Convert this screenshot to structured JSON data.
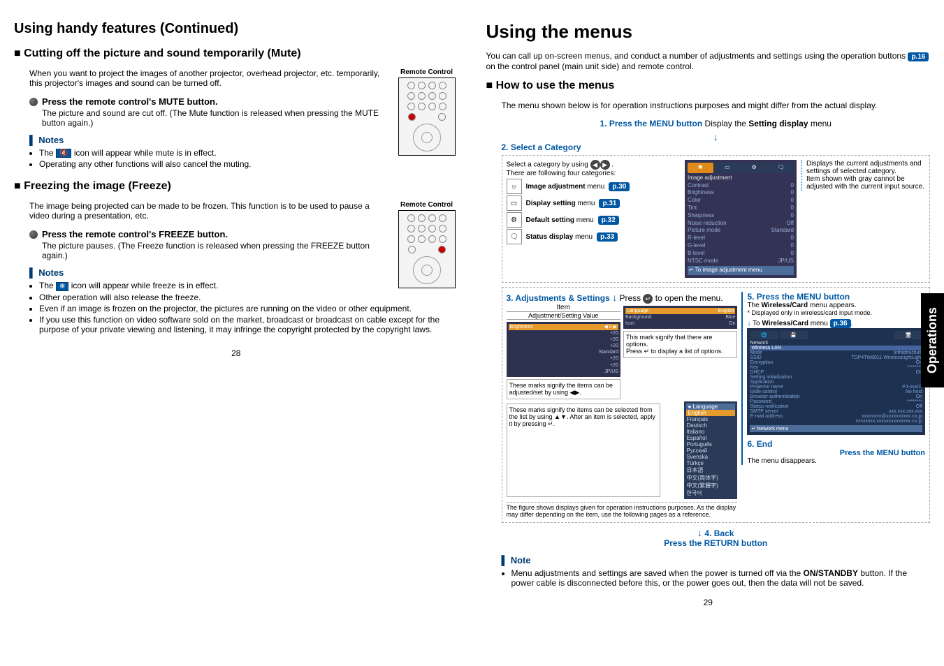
{
  "leftPage": {
    "title": "Using handy features (Continued)",
    "muteSection": {
      "heading": "Cutting off the picture and sound temporarily (Mute)",
      "intro": "When you want to project the images of another projector, overhead projector, etc. temporarily, this projector's images and sound can be turned off.",
      "remoteLabel": "Remote Control",
      "stepTitle": "Press the remote control's MUTE button.",
      "stepBody": "The picture and sound are cut off. (The Mute function is released when pressing the MUTE button again.)",
      "notesTitle": "Notes",
      "note1a": "The ",
      "note1icon": "🔇",
      "note1b": " icon will appear while mute is in effect.",
      "note2": "Operating any other functions will also cancel the muting."
    },
    "freezeSection": {
      "heading": "Freezing the image (Freeze)",
      "intro": "The image being projected can be made to be frozen. This function is to be used to pause a video during a presentation, etc.",
      "remoteLabel": "Remote Control",
      "stepTitle": "Press the remote control's FREEZE button.",
      "stepBody": "The picture pauses. (The Freeze function is released when pressing the FREEZE button again.)",
      "notesTitle": "Notes",
      "note1a": "The ",
      "note1icon": "❄",
      "note1b": " icon will appear while freeze is in effect.",
      "note2": "Other operation will also release the freeze.",
      "note3": "Even if an image is frozen on the projector, the pictures are running on the video or other equipment.",
      "note4": "If you use this function on video software sold on the market, broadcast or broadcast on cable except for the purpose of your private viewing and listening, it may infringe the copyright protected by the copyright laws."
    },
    "pageNumber": "28"
  },
  "rightPage": {
    "title": "Using the menus",
    "intro1": "You can call up on-screen menus, and conduct a number of adjustments and settings using the operation buttons ",
    "introRef": "p.16",
    "intro2": " on the control panel (main unit side) and remote control.",
    "howTo": {
      "heading": "How to use the menus",
      "body": "The menu shown below is for operation instructions purposes and might differ from the actual display."
    },
    "step1": {
      "title": "1. Press the MENU button",
      "after": "Display the ",
      "bold": "Setting display",
      "after2": " menu"
    },
    "step2": {
      "title": "2. Select a Category",
      "selectLine": "Select a category by using ",
      "selectBtns": "◀▶.",
      "catsIntro": "There are following four categories:",
      "items": [
        {
          "icon": "☼",
          "label": "Image adjustment",
          "ref": "p.30",
          "menuWord": " menu"
        },
        {
          "icon": "▭",
          "label": "Display setting",
          "ref": "p.31",
          "menuWord": " menu"
        },
        {
          "icon": "⚙",
          "label": "Default setting",
          "ref": "p.32",
          "menuWord": " menu"
        },
        {
          "icon": "🗨",
          "label": "Status display",
          "ref": "p.33",
          "menuWord": " menu"
        }
      ],
      "screenshot": {
        "header": "Image adjustment",
        "rows": [
          [
            "Contrast",
            "0"
          ],
          [
            "Brightness",
            "0"
          ],
          [
            "Color",
            "0"
          ],
          [
            "Tint",
            "0"
          ],
          [
            "Sharpness",
            "0"
          ],
          [
            "Noise reduction",
            "Off"
          ],
          [
            "Picture mode",
            "Standard"
          ],
          [
            "R-level",
            "0"
          ],
          [
            "G-level",
            "0"
          ],
          [
            "B-level",
            "0"
          ],
          [
            "NTSC mode",
            "JP/US"
          ]
        ],
        "footer": "↵ To image adjustment menu"
      },
      "rightBox": "Displays the current adjustments and settings of selected category.\nItem shown with gray cannot be adjusted with the current input source."
    },
    "step3": {
      "title": "3. Adjustments & Settings",
      "pressLine": "Press ",
      "pressBtn": "↵",
      "pressLine2": " to open the menu.",
      "itemLabel": "Item",
      "adjLabel": "Adjustment/Setting Value",
      "sliderRow": {
        "name": "Brightness",
        "val": "0"
      },
      "listValues": [
        "+20",
        "+20",
        "+20",
        "Standard",
        "+20",
        "+20",
        "JP/US"
      ],
      "annot1": "These marks signify the items can be adjusted/set by using ◀▶.",
      "rightShot": {
        "lang": [
          "Language",
          "English"
        ],
        "bgRows": [
          [
            "Background",
            "Blue"
          ],
          [
            "Icon",
            "On"
          ]
        ]
      },
      "annot2": "This mark signify that there are options.\nPress ↵ to display a list of options.",
      "annotList": "These marks signify the items can be selected from the list by using ▲▼.\nAfter an item is selected, apply it by pressing ↵.",
      "langTitle": "Language",
      "langOpts": [
        "English",
        "Français",
        "Deutsch",
        "Italiano",
        "Español",
        "Português",
        "Русский",
        "Svenska",
        "Türkçe",
        "日本語",
        "中文(简体字)",
        "中文(繁體字)",
        "한국어"
      ],
      "disclaimer": "The figure shows displays given for operation instructions purposes. As the display may differ depending on the item, use the following pages as a reference."
    },
    "step5": {
      "title": "5. Press the MENU button",
      "line1a": "The ",
      "line1bold": "Wireless/Card",
      "line1b": " menu appears.",
      "line2": "* Displayed only in wireless/card input mode.",
      "toLine": "To ",
      "toBold": "Wireless/Card",
      "menuWord": " menu ",
      "ref": "p.36",
      "shot": {
        "header": "Network",
        "sub": "Wireless LAN",
        "rows": [
          [
            "Mode",
            "Infrastructure"
          ],
          [
            "SSID",
            "TDP4TW8011-WirelessrightLight"
          ],
          [
            "Encryption",
            "On"
          ],
          [
            "Key",
            "********"
          ],
          [
            "DHCP",
            "On"
          ],
          [
            "Setting initialization",
            ""
          ],
          [
            "Application",
            ""
          ],
          [
            "Projector name",
            "PJ-xxx01"
          ],
          [
            "Slide control",
            "No host"
          ],
          [
            "Browser authentication",
            "On"
          ],
          [
            "Password",
            "********"
          ],
          [
            "Status notification",
            "Off"
          ],
          [
            "SMTP server",
            "xxx.xxx.xxx.xxx"
          ],
          [
            "E-mail address",
            "xxxxxxxx@xxxxxxxxxx.co.jp"
          ],
          [
            "",
            "xxxxxxxx.xxxxxxxxxxxxxx.co.jp"
          ]
        ],
        "footer": "↵ Network menu"
      }
    },
    "step6": {
      "title": "6. End",
      "press": "Press the MENU button",
      "end": "The menu disappears."
    },
    "step4": {
      "title": "4. Back",
      "press": "Press the RETURN button"
    },
    "note": {
      "title": "Note",
      "body1": "Menu adjustments and settings are saved when the power is turned off via the ",
      "bold": "ON/STANDBY",
      "body2": " button. If the power cable is disconnected before this, or the power goes out, then the data will not be saved."
    },
    "sideTab": "Operations",
    "pageNumber": "29"
  }
}
